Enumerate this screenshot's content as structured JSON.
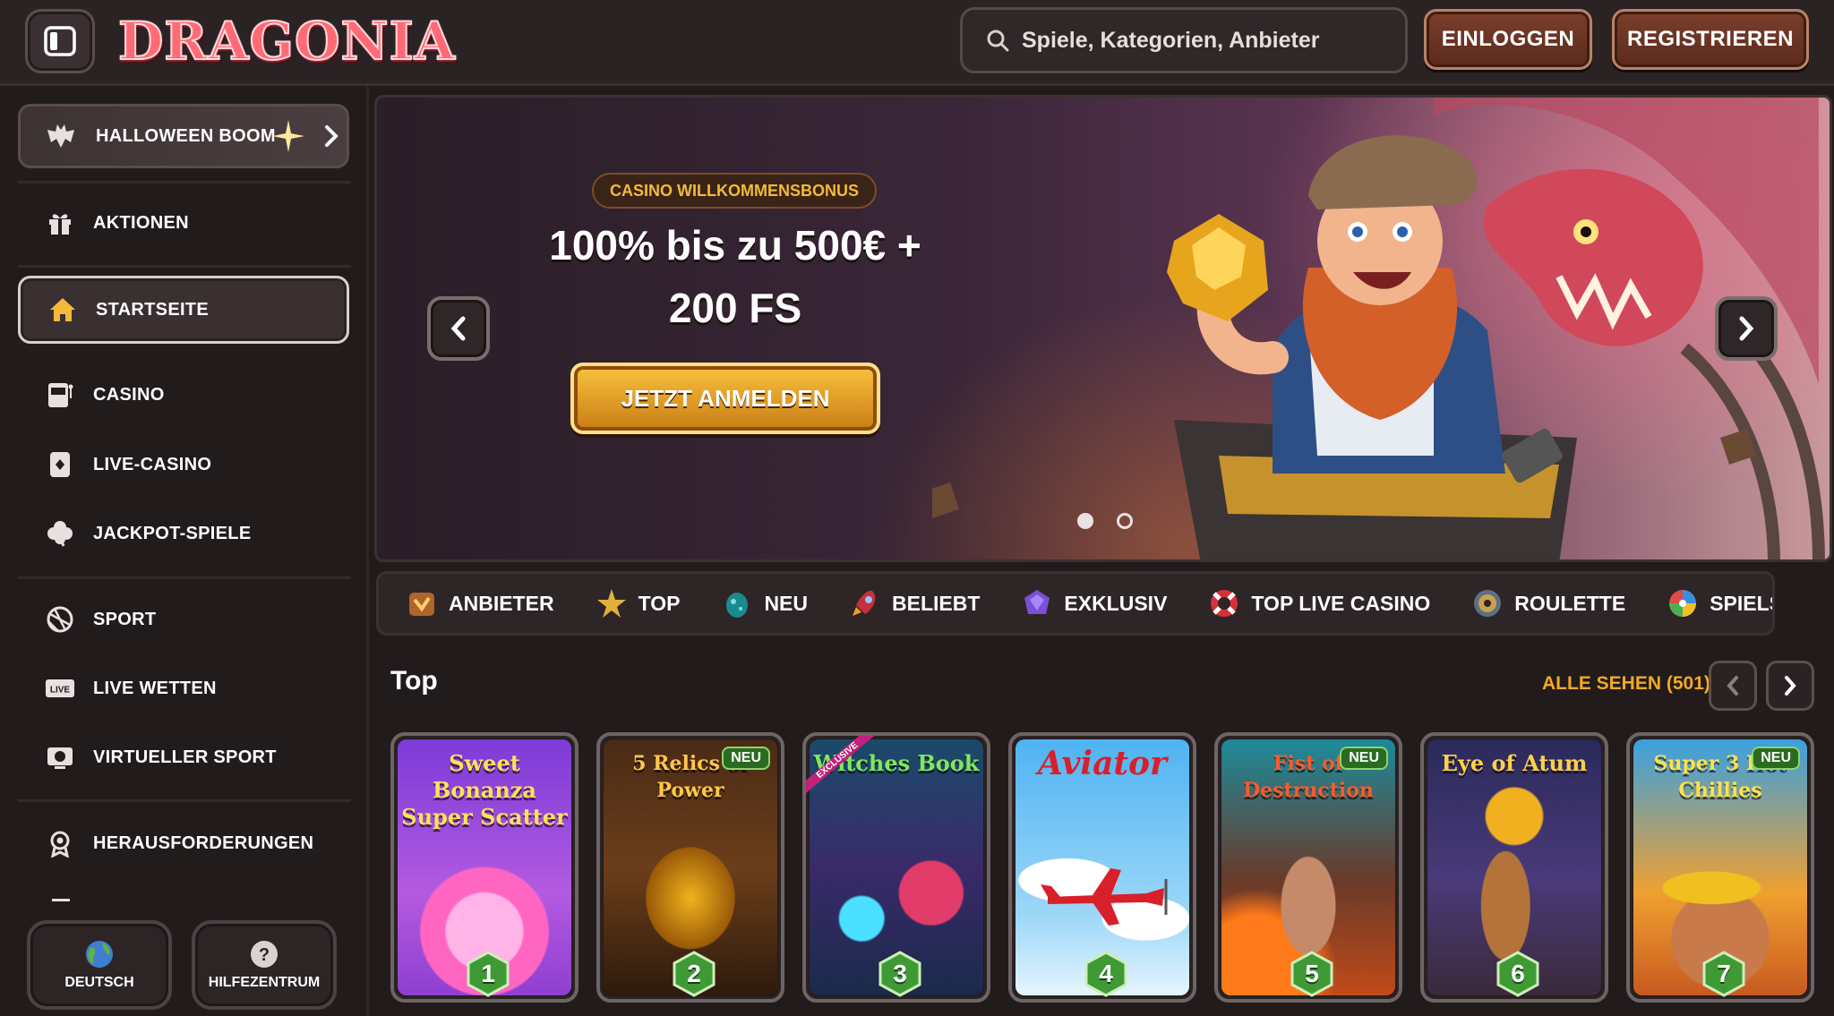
{
  "header": {
    "logo_text": "DRAGONIA",
    "search_placeholder": "Spiele, Kategorien, Anbieter",
    "login_label": "EINLOGGEN",
    "register_label": "REGISTRIEREN"
  },
  "sidebar": {
    "promo_label": "HALLOWEEN BOOM",
    "items": [
      {
        "label": "AKTIONEN",
        "icon": "gift-icon"
      },
      {
        "label": "STARTSEITE",
        "icon": "home-icon"
      },
      {
        "label": "CASINO",
        "icon": "slot-machine-icon"
      },
      {
        "label": "LIVE-CASINO",
        "icon": "card-icon"
      },
      {
        "label": "JACKPOT-SPIELE",
        "icon": "clover-icon"
      },
      {
        "label": "SPORT",
        "icon": "ball-icon"
      },
      {
        "label": "LIVE WETTEN",
        "icon": "live-icon"
      },
      {
        "label": "VIRTUELLER SPORT",
        "icon": "virtual-sport-icon"
      },
      {
        "label": "HERAUSFORDERUNGEN",
        "icon": "challenge-icon"
      }
    ],
    "language_label": "DEUTSCH",
    "help_label": "HILFEZENTRUM"
  },
  "hero": {
    "badge": "CASINO WILLKOMMENSBONUS",
    "title_line1": "100% bis zu 500€ +",
    "title_line2": "200 FS",
    "cta": "JETZT ANMELDEN",
    "slide_count": 2,
    "active_slide": 1
  },
  "categories": [
    {
      "label": "ANBIETER",
      "icon": "provider-icon"
    },
    {
      "label": "TOP",
      "icon": "star-icon"
    },
    {
      "label": "NEU",
      "icon": "egg-icon"
    },
    {
      "label": "BELIEBT",
      "icon": "rocket-icon"
    },
    {
      "label": "EXKLUSIV",
      "icon": "gem-icon"
    },
    {
      "label": "TOP LIVE CASINO",
      "icon": "lifebuoy-icon"
    },
    {
      "label": "ROULETTE",
      "icon": "roulette-icon"
    },
    {
      "label": "SPIELSHOWS",
      "icon": "wheel-icon"
    }
  ],
  "games_section": {
    "title": "Top",
    "see_all": "ALLE SEHEN (501)",
    "games": [
      {
        "name": "Sweet Bonanza Super Scatter",
        "rank": "1",
        "badge": ""
      },
      {
        "name": "5 Relics of Power",
        "rank": "2",
        "badge": "NEU"
      },
      {
        "name": "Witches Book",
        "rank": "3",
        "badge": "EXCLUSIVE"
      },
      {
        "name": "Aviator",
        "rank": "4",
        "badge": ""
      },
      {
        "name": "Fist of Destruction",
        "rank": "5",
        "badge": "NEU"
      },
      {
        "name": "Eye of Atum",
        "rank": "6",
        "badge": ""
      },
      {
        "name": "Super 3 Hot Chillies",
        "rank": "7",
        "badge": "NEU"
      }
    ]
  },
  "colors": {
    "background": "#221b1c",
    "accent_orange": "#f3a923",
    "button_brown": "#7a3f2c",
    "cta_gold": "#f8c23d"
  }
}
